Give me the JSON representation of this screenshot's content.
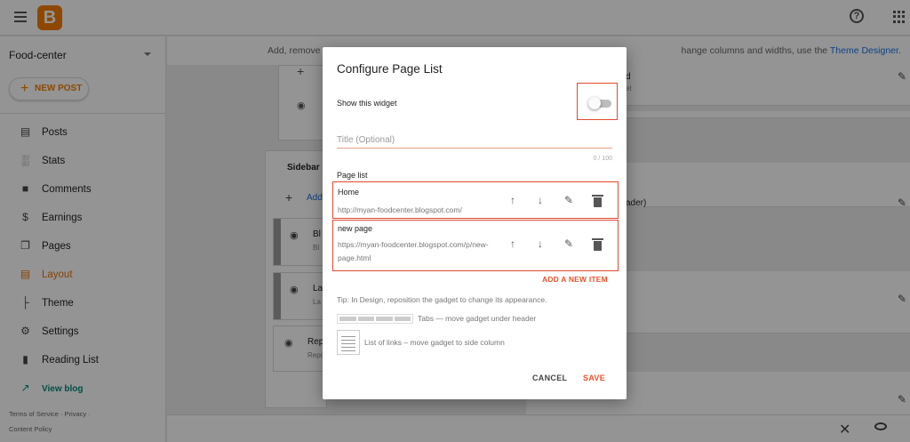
{
  "app": {
    "blog_name": "Food-center",
    "new_post_label": "NEW POST"
  },
  "sidebar": {
    "items": [
      {
        "label": "Posts",
        "icon": "posts-icon"
      },
      {
        "label": "Stats",
        "icon": "stats-icon"
      },
      {
        "label": "Comments",
        "icon": "comments-icon"
      },
      {
        "label": "Earnings",
        "icon": "dollar-icon"
      },
      {
        "label": "Pages",
        "icon": "pages-icon"
      },
      {
        "label": "Layout",
        "icon": "layout-icon"
      },
      {
        "label": "Theme",
        "icon": "paint-roller-icon"
      },
      {
        "label": "Settings",
        "icon": "gear-icon"
      },
      {
        "label": "Reading List",
        "icon": "bookmark-icon"
      },
      {
        "label": "View blog",
        "icon": "external-link-icon"
      }
    ],
    "active": "Layout",
    "footer": {
      "terms": "Terms of Service",
      "privacy": "Privacy",
      "content_policy": "Content Policy"
    }
  },
  "main": {
    "hint_prefix": "Add, remove",
    "hint_suffix": "hange columns and widths, use the",
    "hint_link": "Theme Designer.",
    "sidebar_section": "Sidebar",
    "add_gadget_fragment": "Add",
    "gadget_bl": "Bl",
    "gadget_bl_sub": "Bl",
    "gadget_la": "La",
    "gadget_la_sub": "La",
    "gadget_rep": "Rep",
    "gadget_rep_sub": "Repo",
    "right_frag_1": "d",
    "right_frag_1_sub": "et",
    "right_frag_2": "ader)",
    "right_frag_2_sub": "et"
  },
  "dialog": {
    "title": "Configure Page List",
    "show_widget_label": "Show this widget",
    "show_widget_enabled": false,
    "title_placeholder": "Title (Optional)",
    "title_value": "",
    "char_count": "0 / 100",
    "page_list_label": "Page list",
    "pages": [
      {
        "name": "Home",
        "url": "http://myan-foodcenter.blogspot.com/"
      },
      {
        "name": "new page",
        "url": "https://myan-foodcenter.blogspot.com/p/new-page.html"
      }
    ],
    "add_item_label": "ADD A NEW ITEM",
    "tip": "Tip: In Design, reposition the gadget to change its appearance.",
    "tabs_hint": "Tabs — move gadget under header",
    "links_hint": "List of links – move gadget to side column",
    "cancel_label": "CANCEL",
    "save_label": "SAVE"
  },
  "colors": {
    "brand_orange": "#f57d00",
    "accent_red": "#e8542f",
    "highlight_box": "#e04a2f",
    "link_blue": "#1a73e8",
    "view_blog_teal": "#00897b"
  }
}
